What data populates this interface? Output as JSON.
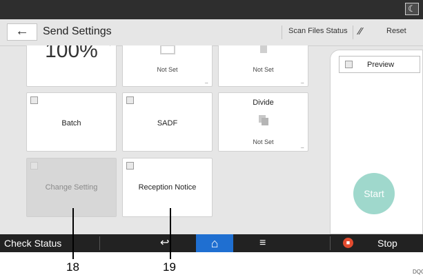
{
  "header": {
    "title": "Send Settings",
    "scan_files_status": "Scan Files Status",
    "reset": "Reset",
    "back_icon": "←",
    "moon_icon": "☾"
  },
  "tiles": {
    "reduce_enlarge_value": "100%",
    "file_type_sub": "Not Set",
    "file_name_sub": "Not Set",
    "more_dots": "...",
    "batch": "Batch",
    "sadf": "SADF",
    "divide": "Divide",
    "divide_sub": "Not Set",
    "change_setting": "Change Setting",
    "reception_notice": "Reception Notice"
  },
  "right_panel": {
    "preview": "Preview",
    "start": "Start"
  },
  "bottom_bar": {
    "check_status": "Check Status",
    "stop": "Stop"
  },
  "callouts": {
    "left": "18",
    "right": "19",
    "figure_code": "DQC"
  },
  "colors": {
    "start_button": "#9fd8cc",
    "home_button": "#1f6fd1",
    "stop_icon": "#e34b2f",
    "bottom_bar": "#222222"
  }
}
